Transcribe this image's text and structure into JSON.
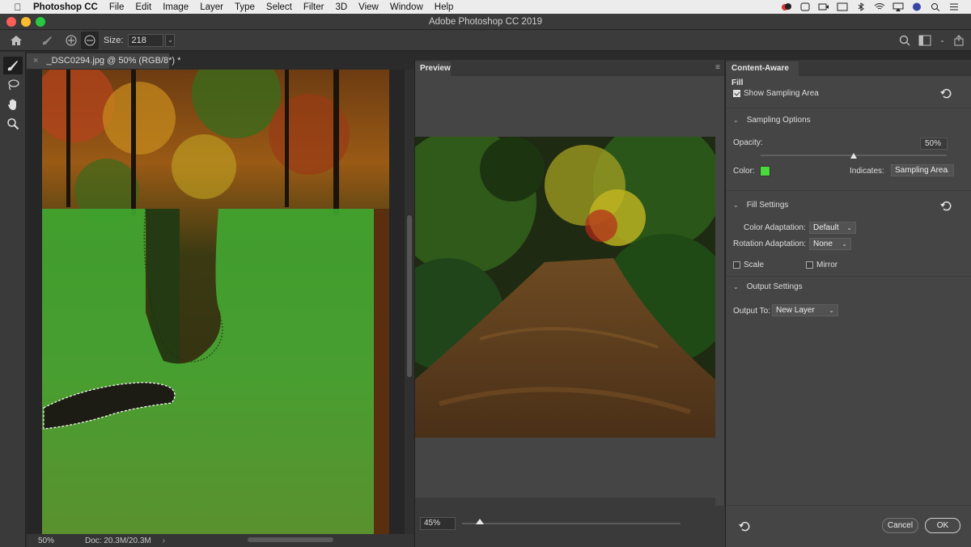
{
  "menubar": {
    "app_name": "Photoshop CC",
    "items": [
      "File",
      "Edit",
      "Image",
      "Layer",
      "Type",
      "Select",
      "Filter",
      "3D",
      "View",
      "Window",
      "Help"
    ]
  },
  "window": {
    "title": "Adobe Photoshop CC 2019"
  },
  "options_bar": {
    "size_label": "Size:",
    "size_value": "218"
  },
  "document": {
    "tab_title": "_DSC0294.jpg @ 50% (RGB/8*) *",
    "zoom": "50%",
    "doc_info": "Doc: 20.3M/20.3M"
  },
  "preview": {
    "tab_label": "Preview",
    "zoom_value": "45%",
    "zoom_fraction": 0.08
  },
  "caf": {
    "tab_label": "Content-Aware Fill",
    "show_sampling_area": {
      "label": "Show Sampling Area",
      "checked": true
    },
    "sampling_options": {
      "header": "Sampling Options",
      "opacity_label": "Opacity:",
      "opacity_value": "50%",
      "opacity_fraction": 0.5,
      "color_label": "Color:",
      "color": "#49d93a",
      "indicates_label": "Indicates:",
      "indicates_value": "Sampling Area"
    },
    "fill_settings": {
      "header": "Fill Settings",
      "color_adaptation_label": "Color Adaptation:",
      "color_adaptation_value": "Default",
      "rotation_adaptation_label": "Rotation Adaptation:",
      "rotation_adaptation_value": "None",
      "scale_label": "Scale",
      "mirror_label": "Mirror"
    },
    "output_settings": {
      "header": "Output Settings",
      "output_to_label": "Output To:",
      "output_to_value": "New Layer"
    },
    "cancel_label": "Cancel",
    "ok_label": "OK"
  },
  "icons": {
    "apple": "apple-icon",
    "home": "home-icon",
    "brush": "brush-icon",
    "lasso": "lasso-icon",
    "hand": "hand-icon",
    "zoom": "zoom-icon",
    "search": "search-icon",
    "reset": "reset-icon"
  }
}
